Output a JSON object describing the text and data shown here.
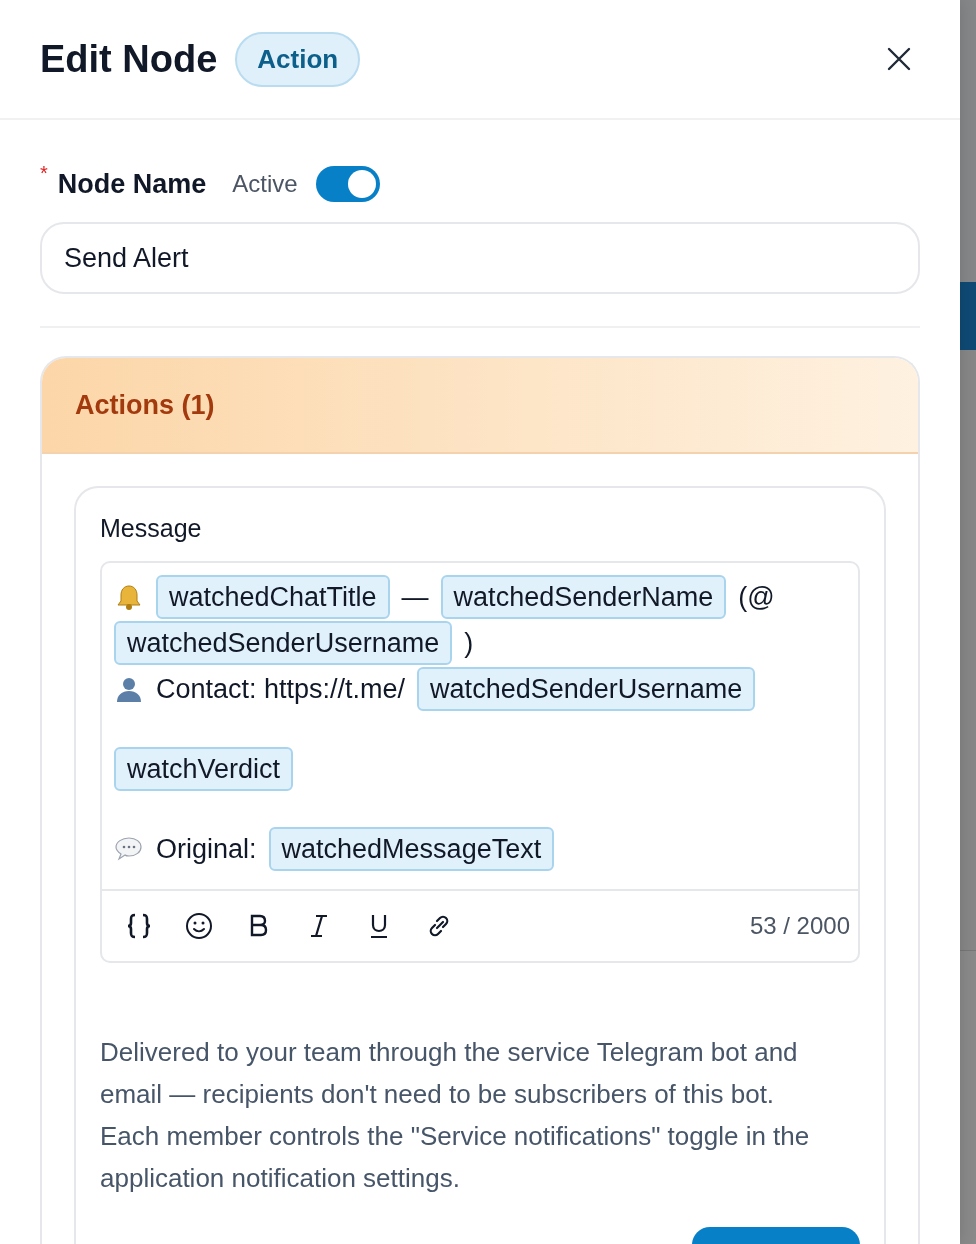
{
  "header": {
    "title": "Edit Node",
    "badge": "Action"
  },
  "node_name": {
    "label": "Node Name",
    "required_mark": "*",
    "active_label": "Active",
    "active": true,
    "value": "Send Alert"
  },
  "actions": {
    "title": "Actions (1)",
    "message": {
      "label": "Message",
      "paragraphs": [
        {
          "kind": "line",
          "segments": [
            {
              "kind": "bell"
            },
            {
              "kind": "chip",
              "text": "watchedChatTitle"
            },
            {
              "kind": "text",
              "text": "—"
            },
            {
              "kind": "chip",
              "text": "watchedSenderName"
            },
            {
              "kind": "text",
              "text": "(@"
            },
            {
              "kind": "chip",
              "text": "watchedSenderUsername"
            },
            {
              "kind": "text",
              "text": ")"
            }
          ]
        },
        {
          "kind": "line",
          "segments": [
            {
              "kind": "person"
            },
            {
              "kind": "text",
              "text": "Contact: https://t.me/"
            },
            {
              "kind": "chip",
              "text": "watchedSenderUsername"
            }
          ]
        },
        {
          "kind": "blank"
        },
        {
          "kind": "line",
          "segments": [
            {
              "kind": "chip",
              "text": "watchVerdict"
            }
          ]
        },
        {
          "kind": "blank"
        },
        {
          "kind": "line",
          "segments": [
            {
              "kind": "bubble"
            },
            {
              "kind": "text",
              "text": "Original:"
            },
            {
              "kind": "chip",
              "text": "watchedMessageText"
            }
          ]
        }
      ],
      "counter": "53 / 2000"
    },
    "note": "Delivered to your team through the service Telegram bot and email — recipients don't need to be subscribers of this bot. Each member controls the \"Service notifications\" toggle in the application notification settings."
  }
}
